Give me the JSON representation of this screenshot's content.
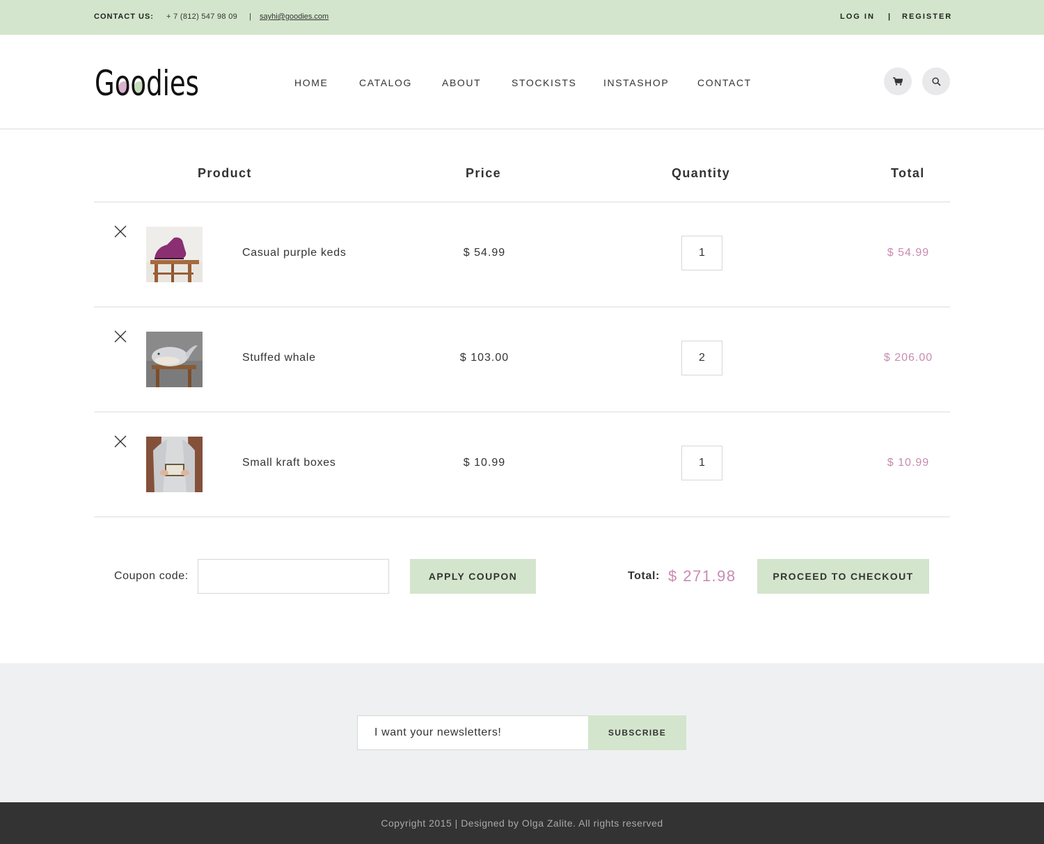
{
  "topbar": {
    "contact_label": "CONTACT US:",
    "phone": "+ 7 (812) 547 98 09",
    "separator": "|",
    "email": "sayhi@goodies.com",
    "login": "LOG IN",
    "register": "REGISTER"
  },
  "header": {
    "logo_text": "Goodies",
    "nav": [
      "HOME",
      "CATALOG",
      "ABOUT",
      "STOCKISTS",
      "INSTASHOP",
      "CONTACT"
    ],
    "cart_icon": "cart-icon",
    "search_icon": "search-icon"
  },
  "cart": {
    "headers": {
      "product": "Product",
      "price": "Price",
      "quantity": "Quantity",
      "total": "Total"
    },
    "items": [
      {
        "name": "Casual purple keds",
        "price": "$ 54.99",
        "quantity": "1",
        "total": "$ 54.99",
        "image": "purple-shoe-on-stool"
      },
      {
        "name": "Stuffed whale",
        "price": "$ 103.00",
        "quantity": "2",
        "total": "$ 206.00",
        "image": "stuffed-whale-on-stool"
      },
      {
        "name": "Small kraft boxes",
        "price": "$ 10.99",
        "quantity": "1",
        "total": "$ 10.99",
        "image": "person-holding-box"
      }
    ],
    "coupon_label": "Coupon code:",
    "coupon_value": "",
    "apply_coupon": "APPLY COUPON",
    "total_label": "Total:",
    "total_value": "$ 271.98",
    "checkout": "PROCEED TO CHECKOUT"
  },
  "newsletter": {
    "input_value": "I want your newsletters!",
    "subscribe": "SUBSCRIBE"
  },
  "footer": {
    "copyright": "Copyright 2015 | Designed by Olga Zalite. All rights reserved"
  },
  "colors": {
    "accent_green": "#d3e5cc",
    "price_pink": "#c98ab0",
    "footer_dark": "#333333",
    "newsletter_bg": "#eff0f2"
  }
}
